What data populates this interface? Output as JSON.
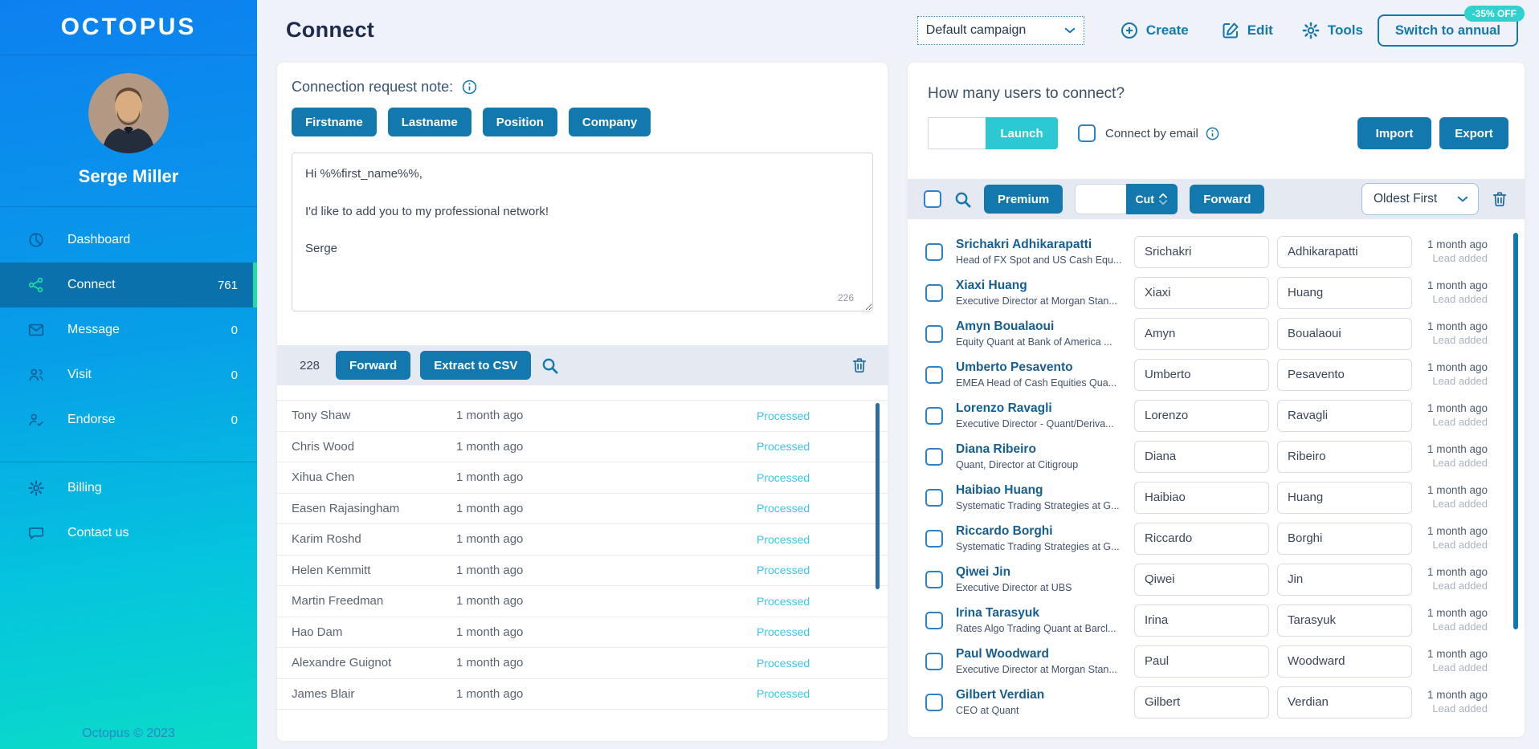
{
  "colors": {
    "accent_blue": "#1278ad",
    "launch_teal": "#2cc8d4",
    "active_green": "#1fdf9f",
    "processed_cyan": "#3cc5e8",
    "badge_teal": "#2fd2cf"
  },
  "sidebar": {
    "logo": "OCTOPUS",
    "user_name": "Serge Miller",
    "nav": [
      {
        "label": "Dashboard",
        "count": ""
      },
      {
        "label": "Connect",
        "count": "761"
      },
      {
        "label": "Message",
        "count": "0"
      },
      {
        "label": "Visit",
        "count": "0"
      },
      {
        "label": "Endorse",
        "count": "0"
      }
    ],
    "secondary_nav": [
      {
        "label": "Billing"
      },
      {
        "label": "Contact us"
      }
    ],
    "footer": "Octopus © 2023"
  },
  "topbar": {
    "title": "Connect",
    "campaign_select": "Default campaign",
    "create_label": "Create",
    "edit_label": "Edit",
    "tools_label": "Tools",
    "switch_annual_label": "Switch to annual",
    "discount_badge": "-35% OFF"
  },
  "note_panel": {
    "header": "Connection request note:",
    "tokens": [
      "Firstname",
      "Lastname",
      "Position",
      "Company"
    ],
    "message": "Hi %%first_name%%,\n\nI'd like to add you to my professional network!\n\nSerge",
    "char_count": "226",
    "queue_count": "228",
    "forward_label": "Forward",
    "extract_label": "Extract to CSV",
    "processed_rows": [
      {
        "name": "Tony Shaw",
        "time": "1 month ago",
        "status": "Processed"
      },
      {
        "name": "Chris Wood",
        "time": "1 month ago",
        "status": "Processed"
      },
      {
        "name": "Xihua Chen",
        "time": "1 month ago",
        "status": "Processed"
      },
      {
        "name": "Easen Rajasingham",
        "time": "1 month ago",
        "status": "Processed"
      },
      {
        "name": "Karim Roshd",
        "time": "1 month ago",
        "status": "Processed"
      },
      {
        "name": "Helen Kemmitt",
        "time": "1 month ago",
        "status": "Processed"
      },
      {
        "name": "Martin Freedman",
        "time": "1 month ago",
        "status": "Processed"
      },
      {
        "name": "Hao Dam",
        "time": "1 month ago",
        "status": "Processed"
      },
      {
        "name": "Alexandre Guignot",
        "time": "1 month ago",
        "status": "Processed"
      },
      {
        "name": "James Blair",
        "time": "1 month ago",
        "status": "Processed"
      }
    ]
  },
  "connect_panel": {
    "header": "How many users to connect?",
    "count_value": "",
    "launch_label": "Launch",
    "connect_by_email_label": "Connect by email",
    "import_label": "Import",
    "export_label": "Export",
    "premium_label": "Premium",
    "cut_value": "",
    "cut_label": "Cut",
    "forward_label": "Forward",
    "sort_select": "Oldest First",
    "users": [
      {
        "name": "Srichakri Adhikarapatti",
        "title": "Head of FX Spot and US Cash Equ...",
        "first": "Srichakri",
        "last": "Adhikarapatti",
        "time": "1 month ago",
        "status": "Lead added"
      },
      {
        "name": "Xiaxi Huang",
        "title": "Executive Director at Morgan Stan...",
        "first": "Xiaxi",
        "last": "Huang",
        "time": "1 month ago",
        "status": "Lead added"
      },
      {
        "name": "Amyn Boualaoui",
        "title": "Equity Quant at Bank of America ...",
        "first": "Amyn",
        "last": "Boualaoui",
        "time": "1 month ago",
        "status": "Lead added"
      },
      {
        "name": "Umberto Pesavento",
        "title": "EMEA Head of Cash Equities Qua...",
        "first": "Umberto",
        "last": "Pesavento",
        "time": "1 month ago",
        "status": "Lead added"
      },
      {
        "name": "Lorenzo Ravagli",
        "title": "Executive Director - Quant/Deriva...",
        "first": "Lorenzo",
        "last": "Ravagli",
        "time": "1 month ago",
        "status": "Lead added"
      },
      {
        "name": "Diana Ribeiro",
        "title": "Quant, Director at Citigroup",
        "first": "Diana",
        "last": "Ribeiro",
        "time": "1 month ago",
        "status": "Lead added"
      },
      {
        "name": "Haibiao Huang",
        "title": "Systematic Trading Strategies at G...",
        "first": "Haibiao",
        "last": "Huang",
        "time": "1 month ago",
        "status": "Lead added"
      },
      {
        "name": "Riccardo Borghi",
        "title": "Systematic Trading Strategies at G...",
        "first": "Riccardo",
        "last": "Borghi",
        "time": "1 month ago",
        "status": "Lead added"
      },
      {
        "name": "Qiwei Jin",
        "title": "Executive Director at UBS",
        "first": "Qiwei",
        "last": "Jin",
        "time": "1 month ago",
        "status": "Lead added"
      },
      {
        "name": "Irina Tarasyuk",
        "title": "Rates Algo Trading Quant at Barcl...",
        "first": "Irina",
        "last": "Tarasyuk",
        "time": "1 month ago",
        "status": "Lead added"
      },
      {
        "name": "Paul Woodward",
        "title": "Executive Director at Morgan Stan...",
        "first": "Paul",
        "last": "Woodward",
        "time": "1 month ago",
        "status": "Lead added"
      },
      {
        "name": "Gilbert Verdian",
        "title": "CEO at Quant",
        "first": "Gilbert",
        "last": "Verdian",
        "time": "1 month ago",
        "status": "Lead added"
      }
    ]
  }
}
